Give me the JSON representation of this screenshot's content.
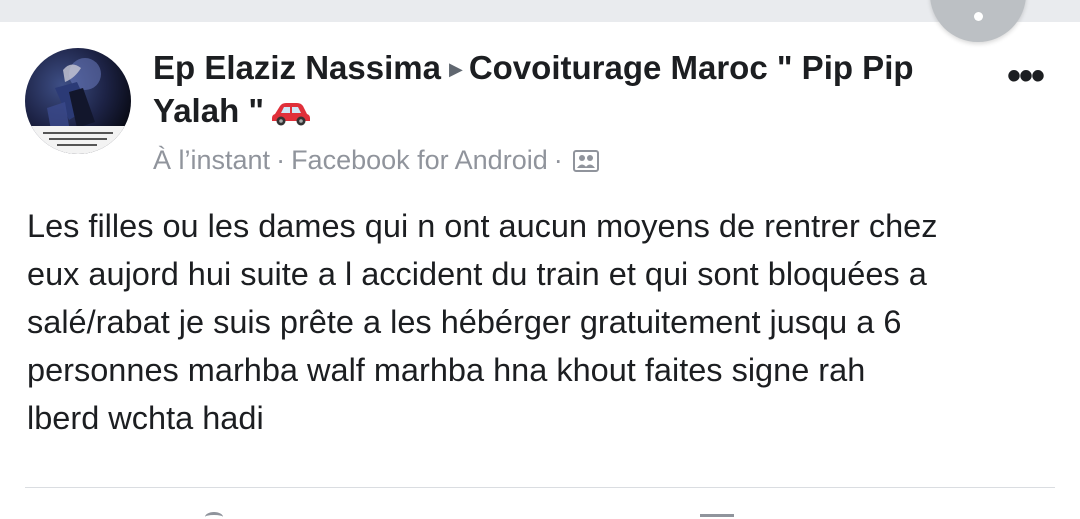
{
  "post": {
    "author": "Ep Elaziz Nassima",
    "group": "Covoiturage Maroc \" Pip Pip",
    "group_cont": "Yalah \"",
    "timestamp": "À l’instant",
    "source": "Facebook for Android",
    "body": [
      "Les filles ou les dames qui n ont aucun moyens de rentrer chez",
      "eux aujord hui suite a l accident du train et qui sont bloquées a",
      "salé/rabat je suis prête a les hébérger gratuitement jusqu a 6",
      "personnes marhba walf marhba hna khout faites signe rah",
      "lberd wchta hadi"
    ]
  },
  "icons": {
    "arrow": "triangle-right-icon",
    "car": "car-icon",
    "more": "more-options-icon",
    "audience": "group-audience-icon"
  },
  "colors": {
    "text": "#1c1e21",
    "meta": "#90949c",
    "car": "#e0303a",
    "divider": "#dadde1"
  }
}
